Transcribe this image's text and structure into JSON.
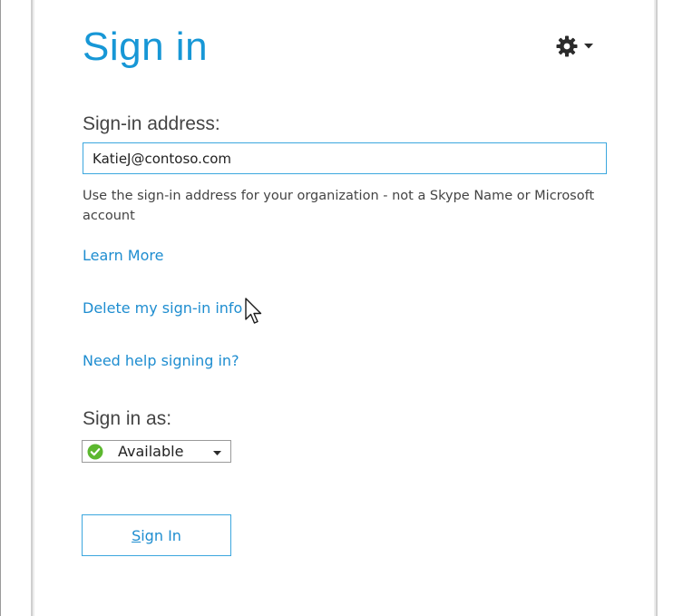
{
  "title": "Sign in",
  "settings": {
    "icon": "gear-icon",
    "caret_icon": "chevron-down-icon"
  },
  "address": {
    "label": "Sign-in address:",
    "value": "KatieJ@contoso.com",
    "hint": "Use the sign-in address for your organization - not a Skype Name or Microsoft account"
  },
  "links": {
    "learn_more": "Learn More",
    "delete_info": "Delete my sign-in info",
    "need_help": "Need help signing in?"
  },
  "status": {
    "label": "Sign in as:",
    "selected": "Available",
    "icon": "available-check-icon",
    "color": "#5cb82f"
  },
  "button": {
    "signin_mnemonic": "S",
    "signin_rest": "ign In"
  },
  "colors": {
    "accent": "#1797d6",
    "link": "#1e8dd0",
    "input_border": "#3ca7de"
  }
}
